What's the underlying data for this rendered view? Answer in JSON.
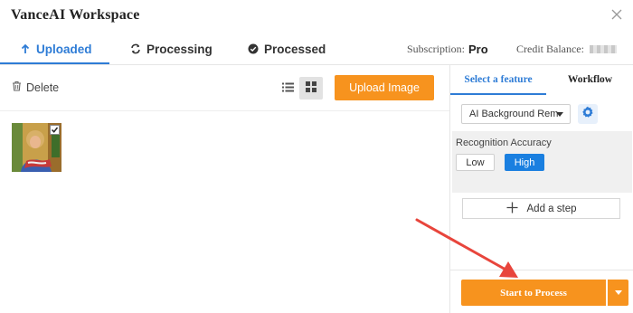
{
  "window": {
    "title": "VanceAI Workspace"
  },
  "tabs": [
    {
      "label": "Uploaded",
      "icon": "arrow-up-icon",
      "active": true
    },
    {
      "label": "Processing",
      "icon": "sync-icon",
      "active": false
    },
    {
      "label": "Processed",
      "icon": "check-circle-icon",
      "active": false
    }
  ],
  "account": {
    "subscription_label": "Subscription:",
    "subscription_value": "Pro",
    "credit_label": "Credit Balance:"
  },
  "toolbar": {
    "delete_label": "Delete",
    "upload_label": "Upload Image",
    "view_mode": "grid"
  },
  "panel": {
    "tabs": [
      {
        "label": "Select a feature",
        "active": true
      },
      {
        "label": "Workflow",
        "active": false
      }
    ],
    "feature_select": "AI Background Rem",
    "recognition_label": "Recognition Accuracy",
    "accuracy_options": [
      {
        "label": "Low",
        "selected": false
      },
      {
        "label": "High",
        "selected": true
      }
    ],
    "add_step_label": "Add a step",
    "start_label": "Start to Process"
  },
  "colors": {
    "accent": "#2e7cd6",
    "primary_button": "#f7931e",
    "selected_option": "#1a7fe0",
    "annotation_arrow": "#e8453c"
  }
}
